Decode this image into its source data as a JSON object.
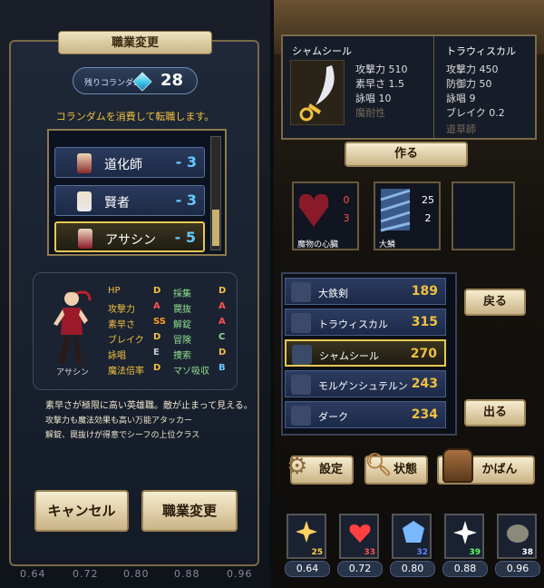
{
  "left": {
    "banner": "職業変更",
    "crystal_label": "残りコランダム",
    "crystal_count": "28",
    "notice": "コランダムを消費して転職します。",
    "jobs": [
      {
        "name": "道化師",
        "cost": "- 3"
      },
      {
        "name": "賢者",
        "cost": "- 3"
      },
      {
        "name": "アサシン",
        "cost": "- 5"
      }
    ],
    "hero_name": "アサシン",
    "stats": [
      {
        "label": "HP",
        "grade": "D"
      },
      {
        "label": "攻撃力",
        "grade": "A"
      },
      {
        "label": "素早さ",
        "grade": "SS"
      },
      {
        "label": "ブレイク",
        "grade": "D"
      },
      {
        "label": "詠唱",
        "grade": "E"
      },
      {
        "label": "魔法倍率",
        "grade": "D"
      }
    ],
    "skills": [
      {
        "label": "採集",
        "grade": "D"
      },
      {
        "label": "罠抜",
        "grade": "A"
      },
      {
        "label": "解錠",
        "grade": "A"
      },
      {
        "label": "冒険",
        "grade": "C"
      },
      {
        "label": "捜索",
        "grade": "D"
      },
      {
        "label": "マソ吸収",
        "grade": "B"
      }
    ],
    "description": [
      "素早さが極限に高い英雄職。敵が止まって見える。",
      "攻撃力も魔法効果も高い万能アタッカー",
      "解錠、罠抜けが得意でシーフの上位クラス"
    ],
    "cancel_label": "キャンセル",
    "confirm_label": "職業変更",
    "footer": [
      "0.64",
      "0.72",
      "0.80",
      "0.88",
      "0.96"
    ]
  },
  "right": {
    "weapon_a": {
      "name": "シャムシール",
      "stats": [
        "攻撃力 510",
        "素早さ 1.5",
        "詠唱 10",
        "魔耐性"
      ]
    },
    "weapon_b": {
      "name": "トラウィスカル",
      "stats": [
        "攻撃力 450",
        "防御力 50",
        "詠唱 9",
        "ブレイク 0.2",
        "道草師"
      ]
    },
    "make_label": "作る",
    "materials": [
      {
        "name": "魔物の心臓",
        "have": "0",
        "need": "3"
      },
      {
        "name": "大鱗",
        "have": "25",
        "need": "2"
      }
    ],
    "weapons": [
      {
        "name": "大鉄剣",
        "price": "189"
      },
      {
        "name": "トラウィスカル",
        "price": "315"
      },
      {
        "name": "シャムシール",
        "price": "270"
      },
      {
        "name": "モルゲンシュテルン",
        "price": "243"
      },
      {
        "name": "ダーク",
        "price": "234"
      }
    ],
    "back_label": "戻る",
    "exit_label": "出る",
    "tabs": [
      "設定",
      "状態",
      "かばん"
    ],
    "slots": [
      {
        "count": "25",
        "value": "0.64",
        "color": "#ffd040"
      },
      {
        "count": "33",
        "value": "0.72",
        "color": "#ff5050"
      },
      {
        "count": "32",
        "value": "0.80",
        "color": "#6080ff"
      },
      {
        "count": "39",
        "value": "0.88",
        "color": "#60ff60"
      },
      {
        "count": "38",
        "value": "0.96",
        "color": "#ffffff"
      }
    ]
  }
}
